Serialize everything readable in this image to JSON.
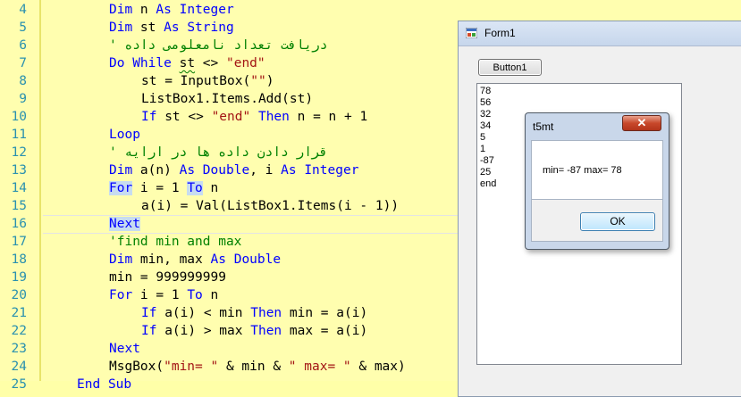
{
  "editor": {
    "lines": [
      {
        "num": "4",
        "segments": [
          {
            "t": "Dim",
            "c": "kw"
          },
          {
            "t": " n ",
            "c": ""
          },
          {
            "t": "As",
            "c": "kw"
          },
          {
            "t": " ",
            "c": ""
          },
          {
            "t": "Integer",
            "c": "kw"
          }
        ]
      },
      {
        "num": "5",
        "segments": [
          {
            "t": "Dim",
            "c": "kw"
          },
          {
            "t": " st ",
            "c": ""
          },
          {
            "t": "As",
            "c": "kw"
          },
          {
            "t": " ",
            "c": ""
          },
          {
            "t": "String",
            "c": "kw"
          }
        ]
      },
      {
        "num": "6",
        "segments": [
          {
            "t": "' دریافت تعداد نامعلومی داده",
            "c": "com"
          }
        ]
      },
      {
        "num": "7",
        "segments": [
          {
            "t": "Do",
            "c": "kw"
          },
          {
            "t": " ",
            "c": ""
          },
          {
            "t": "While",
            "c": "kw"
          },
          {
            "t": " ",
            "c": ""
          },
          {
            "t": "st",
            "c": "squig"
          },
          {
            "t": " <> ",
            "c": ""
          },
          {
            "t": "\"end\"",
            "c": "str"
          }
        ]
      },
      {
        "num": "8",
        "segments": [
          {
            "t": "st = InputBox(",
            "c": ""
          },
          {
            "t": "\"\"",
            "c": "str"
          },
          {
            "t": ")",
            "c": ""
          }
        ]
      },
      {
        "num": "9",
        "segments": [
          {
            "t": "ListBox1.Items.Add(st)",
            "c": ""
          }
        ]
      },
      {
        "num": "10",
        "segments": [
          {
            "t": "If",
            "c": "kw"
          },
          {
            "t": " st <> ",
            "c": ""
          },
          {
            "t": "\"end\"",
            "c": "str"
          },
          {
            "t": " ",
            "c": ""
          },
          {
            "t": "Then",
            "c": "kw"
          },
          {
            "t": " n = n + 1",
            "c": ""
          }
        ]
      },
      {
        "num": "11",
        "segments": [
          {
            "t": "Loop",
            "c": "kw"
          }
        ]
      },
      {
        "num": "12",
        "segments": [
          {
            "t": "' قرار دادن داده ها در ارایه",
            "c": "com"
          }
        ]
      },
      {
        "num": "13",
        "segments": [
          {
            "t": "Dim",
            "c": "kw"
          },
          {
            "t": " a(n) ",
            "c": ""
          },
          {
            "t": "As",
            "c": "kw"
          },
          {
            "t": " ",
            "c": ""
          },
          {
            "t": "Double",
            "c": "kw"
          },
          {
            "t": ", i ",
            "c": ""
          },
          {
            "t": "As",
            "c": "kw"
          },
          {
            "t": " ",
            "c": ""
          },
          {
            "t": "Integer",
            "c": "kw"
          }
        ]
      },
      {
        "num": "14",
        "segments": [
          {
            "t": "For",
            "c": "kw hl"
          },
          {
            "t": " i = 1 ",
            "c": ""
          },
          {
            "t": "To",
            "c": "kw hl"
          },
          {
            "t": " n",
            "c": ""
          }
        ]
      },
      {
        "num": "15",
        "segments": [
          {
            "t": "a(i) = Val(ListBox1.Items(i - 1))",
            "c": ""
          }
        ]
      },
      {
        "num": "16",
        "segments": [
          {
            "t": "Next",
            "c": "kw hl"
          }
        ]
      },
      {
        "num": "17",
        "segments": [
          {
            "t": "'find min and max",
            "c": "com"
          }
        ]
      },
      {
        "num": "18",
        "segments": [
          {
            "t": "Dim",
            "c": "kw"
          },
          {
            "t": " min, max ",
            "c": ""
          },
          {
            "t": "As",
            "c": "kw"
          },
          {
            "t": " ",
            "c": ""
          },
          {
            "t": "Double",
            "c": "kw"
          }
        ]
      },
      {
        "num": "19",
        "segments": [
          {
            "t": "min = 999999999",
            "c": ""
          }
        ]
      },
      {
        "num": "20",
        "segments": [
          {
            "t": "For",
            "c": "kw"
          },
          {
            "t": " i = 1 ",
            "c": ""
          },
          {
            "t": "To",
            "c": "kw"
          },
          {
            "t": " n",
            "c": ""
          }
        ]
      },
      {
        "num": "21",
        "segments": [
          {
            "t": "If",
            "c": "kw"
          },
          {
            "t": " a(i) < min ",
            "c": ""
          },
          {
            "t": "Then",
            "c": "kw"
          },
          {
            "t": " min = a(i)",
            "c": ""
          }
        ]
      },
      {
        "num": "22",
        "segments": [
          {
            "t": "If",
            "c": "kw"
          },
          {
            "t": " a(i) > max ",
            "c": ""
          },
          {
            "t": "Then",
            "c": "kw"
          },
          {
            "t": " max = a(i)",
            "c": ""
          }
        ]
      },
      {
        "num": "23",
        "segments": [
          {
            "t": "Next",
            "c": "kw"
          }
        ]
      },
      {
        "num": "24",
        "segments": [
          {
            "t": "MsgBox(",
            "c": ""
          },
          {
            "t": "\"min= \"",
            "c": "str"
          },
          {
            "t": " & min & ",
            "c": ""
          },
          {
            "t": "\" max= \"",
            "c": "str"
          },
          {
            "t": " & max)",
            "c": ""
          }
        ]
      },
      {
        "num": "25",
        "segments": [
          {
            "t": "End",
            "c": "kw"
          },
          {
            "t": " ",
            "c": ""
          },
          {
            "t": "Sub",
            "c": "kw"
          }
        ]
      }
    ],
    "colors": {
      "keyword": "#0000ff",
      "string": "#a31515",
      "comment": "#008000",
      "line_number": "#2b91af",
      "background": "#fffeaf"
    }
  },
  "form1": {
    "title": "Form1",
    "button_label": "Button1",
    "listbox_items": [
      "78",
      "56",
      "32",
      "34",
      "5",
      "1",
      "-87",
      "25",
      "end"
    ]
  },
  "msgbox": {
    "title": "t5mt",
    "close_label": "✕",
    "message": "min= -87 max= 78",
    "ok_label": "OK"
  }
}
